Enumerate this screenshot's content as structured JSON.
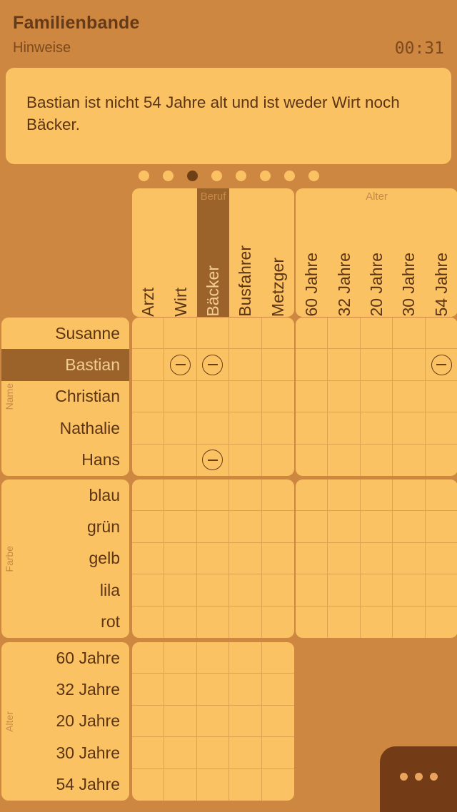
{
  "header": {
    "title": "Familienbande",
    "subtitle": "Hinweise",
    "timer": "00:31"
  },
  "clue": {
    "text": "Bastian ist nicht 54 Jahre alt und ist weder Wirt noch Bäcker."
  },
  "pagination": {
    "total": 8,
    "active_index": 2
  },
  "colors": {
    "background": "#ce8740",
    "card": "#fbc263",
    "highlight": "#9b632a",
    "text_dark": "#5b3413",
    "gridline": "#dfa250",
    "menu_panel": "#733c17"
  },
  "groups": {
    "col_top_left": {
      "label": "Beruf",
      "items": [
        "Arzt",
        "Wirt",
        "Bäcker",
        "Busfahrer",
        "Metzger"
      ],
      "highlight_index": 2
    },
    "col_top_right": {
      "label": "Alter",
      "items": [
        "60 Jahre",
        "32 Jahre",
        "20 Jahre",
        "30 Jahre",
        "54 Jahre"
      ],
      "highlight_index": -1
    },
    "row_name": {
      "label": "Name",
      "items": [
        "Susanne",
        "Bastian",
        "Christian",
        "Nathalie",
        "Hans"
      ],
      "highlight_index": 1
    },
    "row_farbe": {
      "label": "Farbe",
      "items": [
        "blau",
        "grün",
        "gelb",
        "lila",
        "rot"
      ],
      "highlight_index": -1
    },
    "row_alter": {
      "label": "Alter",
      "items": [
        "60 Jahre",
        "32 Jahre",
        "20 Jahre",
        "30 Jahre",
        "54 Jahre"
      ],
      "highlight_index": -1
    }
  },
  "marks": {
    "name_beruf": [
      {
        "row": 1,
        "col": 1,
        "mark": "minus"
      },
      {
        "row": 1,
        "col": 2,
        "mark": "minus"
      },
      {
        "row": 4,
        "col": 2,
        "mark": "minus"
      }
    ],
    "name_alter": [
      {
        "row": 1,
        "col": 4,
        "mark": "minus"
      }
    ],
    "farbe_beruf": [],
    "farbe_alter": [],
    "alter_beruf": []
  },
  "menu": {
    "label": "more-options",
    "dots": 3
  }
}
